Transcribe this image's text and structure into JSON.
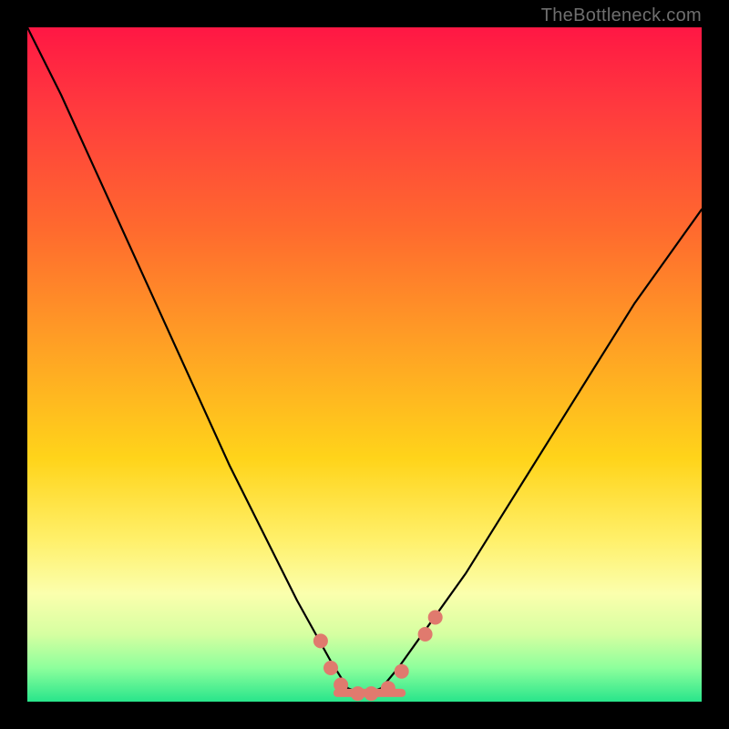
{
  "watermark": {
    "text": "TheBottleneck.com"
  },
  "chart_data": {
    "type": "line",
    "title": "",
    "xlabel": "",
    "ylabel": "",
    "xlim": [
      0,
      1
    ],
    "ylim": [
      0,
      1
    ],
    "series": [
      {
        "name": "curve",
        "x": [
          0.0,
          0.05,
          0.1,
          0.15,
          0.2,
          0.25,
          0.3,
          0.35,
          0.4,
          0.45,
          0.475,
          0.5,
          0.525,
          0.55,
          0.6,
          0.65,
          0.7,
          0.75,
          0.8,
          0.85,
          0.9,
          0.95,
          1.0
        ],
        "y": [
          1.0,
          0.9,
          0.79,
          0.68,
          0.57,
          0.46,
          0.35,
          0.25,
          0.15,
          0.06,
          0.02,
          0.01,
          0.02,
          0.05,
          0.12,
          0.19,
          0.27,
          0.35,
          0.43,
          0.51,
          0.59,
          0.66,
          0.73
        ]
      }
    ],
    "markers": {
      "name": "highlight-points",
      "color": "#e07a6e",
      "x": [
        0.435,
        0.45,
        0.465,
        0.49,
        0.51,
        0.535,
        0.555,
        0.59,
        0.605
      ],
      "y": [
        0.09,
        0.05,
        0.025,
        0.012,
        0.012,
        0.02,
        0.045,
        0.1,
        0.125
      ]
    },
    "flat_segment": {
      "color": "#e07a6e",
      "x0": 0.46,
      "x1": 0.555,
      "y": 0.013
    }
  }
}
